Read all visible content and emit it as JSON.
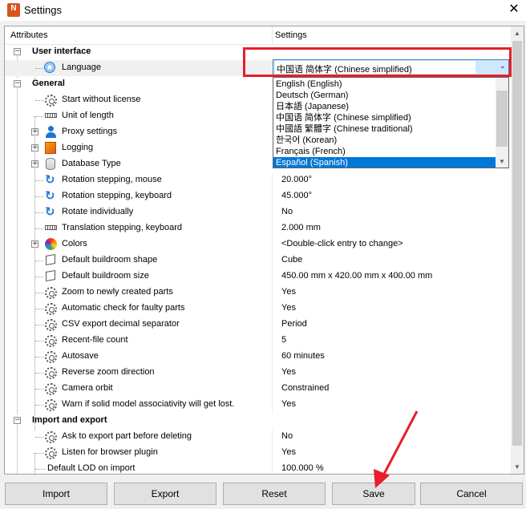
{
  "window": {
    "title": "Settings",
    "app_icon": "N",
    "close_glyph": "✕"
  },
  "header": {
    "attributes": "Attributes",
    "settings": "Settings"
  },
  "sections": {
    "user_interface": "User interface",
    "general": "General",
    "import_export": "Import and export"
  },
  "rows": {
    "language": {
      "label": "Language"
    },
    "start_without_license": {
      "label": "Start without license"
    },
    "unit_of_length": {
      "label": "Unit of length"
    },
    "proxy_settings": {
      "label": "Proxy settings"
    },
    "logging": {
      "label": "Logging"
    },
    "database_type": {
      "label": "Database Type"
    },
    "rotation_mouse": {
      "label": "Rotation stepping, mouse",
      "value": "20.000°"
    },
    "rotation_keyboard": {
      "label": "Rotation stepping, keyboard",
      "value": "45.000°"
    },
    "rotate_individually": {
      "label": "Rotate individually",
      "value": "No"
    },
    "translation_keyboard": {
      "label": "Translation stepping, keyboard",
      "value": "2.000 mm"
    },
    "colors": {
      "label": "Colors",
      "value": "<Double-click entry to change>"
    },
    "buildroom_shape": {
      "label": "Default buildroom shape",
      "value": "Cube"
    },
    "buildroom_size": {
      "label": "Default buildroom size",
      "value": "450.00 mm x 420.00 mm x 400.00 mm"
    },
    "zoom_new_parts": {
      "label": "Zoom to newly created parts",
      "value": "Yes"
    },
    "auto_check": {
      "label": "Automatic check for faulty parts",
      "value": "Yes"
    },
    "csv_separator": {
      "label": "CSV export decimal separator",
      "value": "Period"
    },
    "recent_files": {
      "label": "Recent-file count",
      "value": "5"
    },
    "autosave": {
      "label": "Autosave",
      "value": "60 minutes"
    },
    "reverse_zoom": {
      "label": "Reverse zoom direction",
      "value": "Yes"
    },
    "camera_orbit": {
      "label": "Camera orbit",
      "value": "Constrained"
    },
    "warn_solid": {
      "label": "Warn if solid model associativity will get lost.",
      "value": "Yes"
    },
    "ask_export": {
      "label": "Ask to export part before deleting",
      "value": "No"
    },
    "browser_plugin": {
      "label": "Listen for browser plugin",
      "value": "Yes"
    },
    "default_lod": {
      "label": "Default LOD on import",
      "value": "100.000 %"
    }
  },
  "language_combo": {
    "selected": "中国语 简体字 (Chinese simplified)",
    "options": [
      "English (English)",
      "Deutsch (German)",
      "日本語 (Japanese)",
      "中国语 简体字 (Chinese simplified)",
      "中國語 繁體字 (Chinese traditional)",
      "한국어 (Korean)",
      "Français (French)",
      "Español (Spanish)"
    ],
    "highlighted_index": 7,
    "highlight_color": "#e81e2a"
  },
  "buttons": {
    "import": "Import",
    "export": "Export",
    "reset": "Reset",
    "save": "Save",
    "cancel": "Cancel"
  },
  "colors": {
    "selection": "#0078d7",
    "annotation": "#e81e2a"
  }
}
